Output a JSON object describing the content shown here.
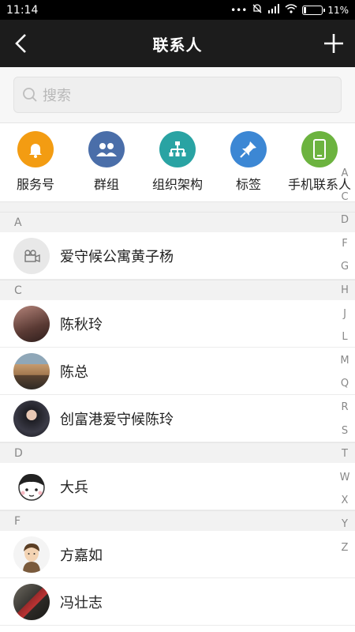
{
  "status": {
    "time": "11:14",
    "battery": "11%",
    "battery_level": 0.11
  },
  "header": {
    "title": "联系人"
  },
  "search": {
    "placeholder": "搜索"
  },
  "quick_actions": [
    {
      "label": "服务号",
      "icon": "bell-icon",
      "color": "#f39c12"
    },
    {
      "label": "群组",
      "icon": "group-icon",
      "color": "#4a6ea9"
    },
    {
      "label": "组织架构",
      "icon": "org-chart-icon",
      "color": "#29a3a3"
    },
    {
      "label": "标签",
      "icon": "pin-icon",
      "color": "#3c87d4"
    },
    {
      "label": "手机联系人",
      "icon": "phone-icon",
      "color": "#6cb33f"
    }
  ],
  "sections": [
    {
      "letter": "A",
      "contacts": [
        {
          "name": "爱守候公寓黄子杨"
        }
      ]
    },
    {
      "letter": "C",
      "contacts": [
        {
          "name": "陈秋玲"
        },
        {
          "name": "陈总"
        },
        {
          "name": "创富港爱守候陈玲"
        }
      ]
    },
    {
      "letter": "D",
      "contacts": [
        {
          "name": "大兵"
        }
      ]
    },
    {
      "letter": "F",
      "contacts": [
        {
          "name": "方嘉如"
        },
        {
          "name": "冯壮志"
        }
      ]
    }
  ],
  "index_letters": [
    "A",
    "C",
    "D",
    "F",
    "G",
    "H",
    "J",
    "L",
    "M",
    "Q",
    "R",
    "S",
    "T",
    "W",
    "X",
    "Y",
    "Z"
  ]
}
